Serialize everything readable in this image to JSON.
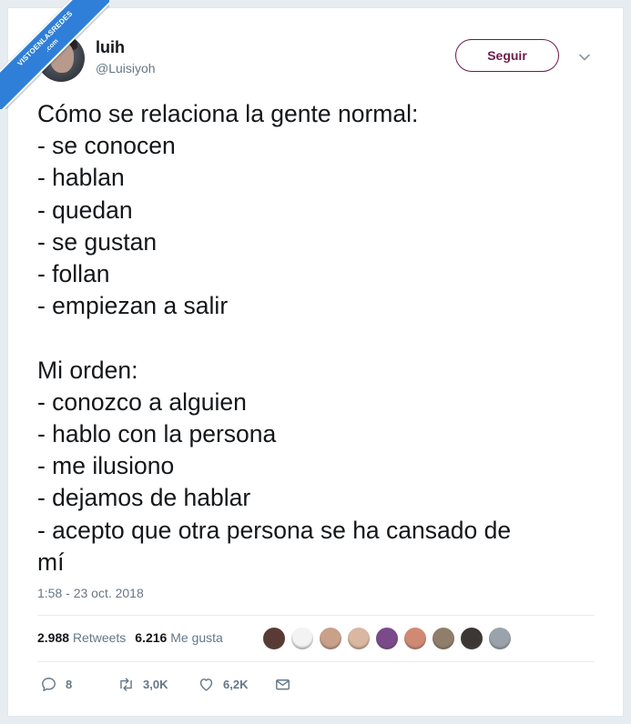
{
  "watermark": {
    "line1": "VISTOENLASREDES",
    "line2": ".com"
  },
  "user": {
    "name": "luih",
    "handle": "@Luisiyoh",
    "follow_label": "Seguir"
  },
  "tweet": {
    "text": "Cómo se relaciona la gente normal:\n- se conocen\n- hablan\n- quedan\n- se gustan\n- follan\n- empiezan a salir\n\nMi orden:\n- conozco a alguien\n- hablo con la persona\n- me ilusiono\n- dejamos de hablar\n- acepto que otra persona se ha cansado de\nmí",
    "timestamp": "1:58 - 23 oct. 2018"
  },
  "stats": {
    "retweets_count": "2.988",
    "retweets_label": "Retweets",
    "likes_count": "6.216",
    "likes_label": "Me gusta"
  },
  "actions": {
    "replies": "8",
    "retweets": "3,0K",
    "likes": "6,2K"
  },
  "icons": [
    "chevron-down-icon",
    "reply-icon",
    "retweet-icon",
    "heart-icon",
    "mail-icon"
  ],
  "colors": {
    "follow_accent": "#6e1a4a",
    "secondary_text": "#657786",
    "primary_text": "#14171a",
    "watermark_blue": "#2f7fd8"
  },
  "liker_avatar_colors": [
    "#5a3a34",
    "#f3f3f3",
    "#c9a089",
    "#d9b7a1",
    "#7b4a8a",
    "#d08a74",
    "#8f7f6a",
    "#3d3733",
    "#9aa3ab"
  ]
}
